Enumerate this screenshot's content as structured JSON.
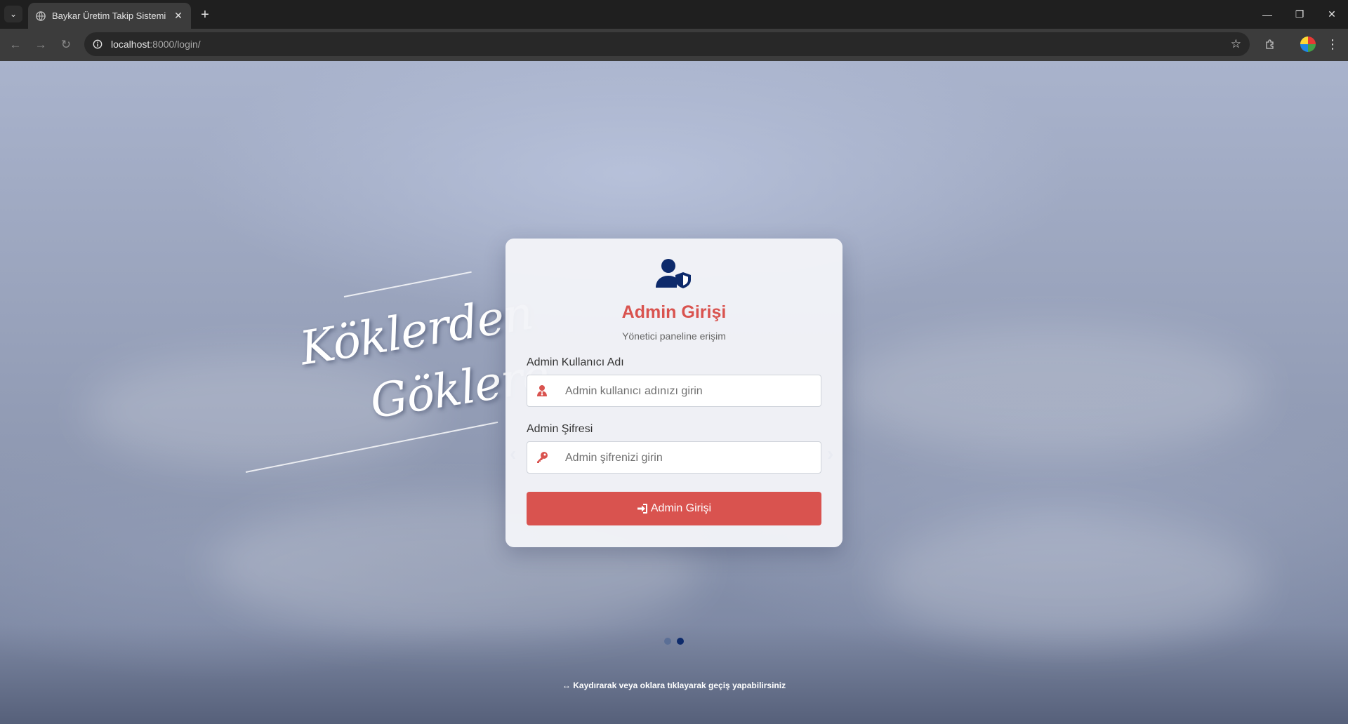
{
  "browser": {
    "tab_title": "Baykar Üretim Takip Sistemi - G",
    "url_host": "localhost",
    "url_path": ":8000/login/",
    "icons": {
      "tab_list": "chevron-down-icon",
      "favicon": "globe-icon",
      "tab_close": "close-icon",
      "new_tab": "plus-icon",
      "back": "arrow-left-icon",
      "forward": "arrow-right-icon",
      "reload": "reload-icon",
      "site_info": "info-icon",
      "bookmark": "star-icon",
      "extensions": "puzzle-icon",
      "profile": "avatar",
      "menu": "kebab-menu-icon",
      "minimize": "minimize-icon",
      "restore": "restore-icon",
      "close_window": "close-icon"
    }
  },
  "slogan": {
    "line1": "Köklerden",
    "line2": "Göklere"
  },
  "login_card": {
    "icon": "user-shield-icon",
    "title": "Admin Girişi",
    "subtitle": "Yönetici paneline erişim",
    "username": {
      "label": "Admin Kullanıcı Adı",
      "placeholder": "Admin kullanıcı adınızı girin",
      "value": "",
      "icon": "user-tie-icon"
    },
    "password": {
      "label": "Admin Şifresi",
      "placeholder": "Admin şifrenizi girin",
      "value": "",
      "icon": "key-icon"
    },
    "submit_label": "Admin Girişi",
    "submit_icon": "sign-in-icon"
  },
  "carousel": {
    "prev": "‹",
    "next": "›",
    "slides": 2,
    "active_slide": 2,
    "hint": "↔ Kaydırarak veya oklara tıklayarak geçiş yapabilirsiniz"
  },
  "colors": {
    "accent_red": "#d9534f",
    "navy": "#0d2a6b",
    "dot_inactive": "#5b6f96"
  }
}
